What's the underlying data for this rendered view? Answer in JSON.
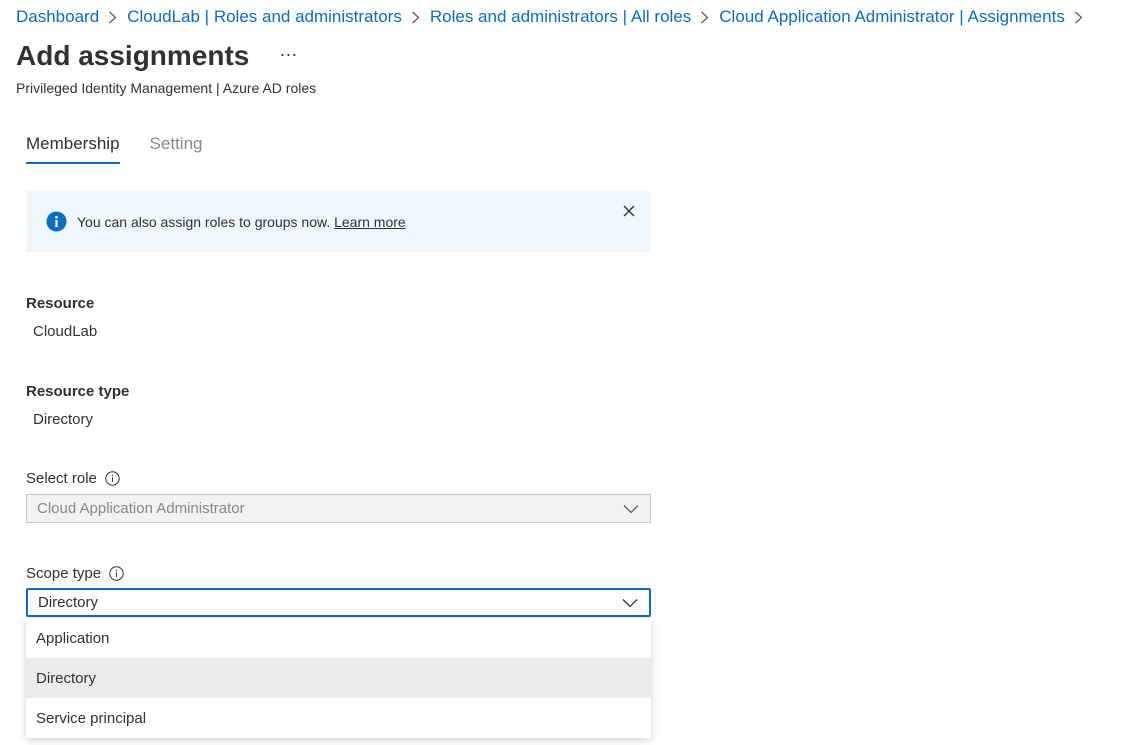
{
  "breadcrumb": [
    {
      "label": "Dashboard"
    },
    {
      "label": "CloudLab | Roles and administrators"
    },
    {
      "label": "Roles and administrators | All roles"
    },
    {
      "label": "Cloud Application Administrator | Assignments"
    }
  ],
  "header": {
    "title": "Add assignments",
    "more_label": "···",
    "subtitle": "Privileged Identity Management | Azure AD roles"
  },
  "tabs": [
    {
      "label": "Membership",
      "active": true
    },
    {
      "label": "Setting",
      "active": false
    }
  ],
  "banner": {
    "text": "You can also assign roles to groups now.",
    "link": "Learn more",
    "icon": "info-icon"
  },
  "resource": {
    "label": "Resource",
    "value": "CloudLab"
  },
  "resource_type": {
    "label": "Resource type",
    "value": "Directory"
  },
  "select_role": {
    "label": "Select role",
    "value": "Cloud Application Administrator",
    "disabled": true
  },
  "scope_type": {
    "label": "Scope type",
    "value": "Directory",
    "options": [
      "Application",
      "Directory",
      "Service principal"
    ],
    "selected_index": 1
  },
  "colors": {
    "accent": "#0f6cbd",
    "banner_bg": "#eff6fc",
    "selected_option_bg": "#edebe9"
  }
}
